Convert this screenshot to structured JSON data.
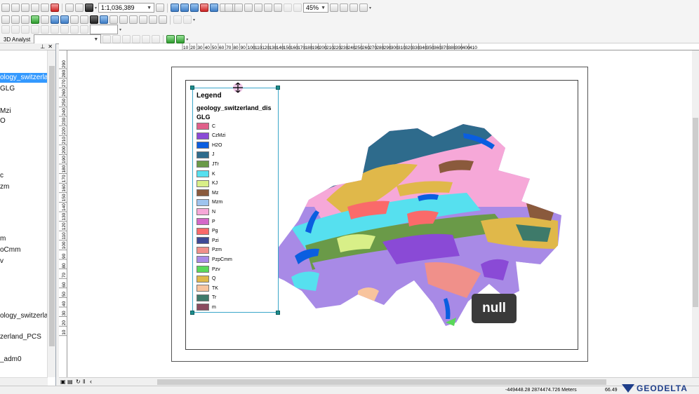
{
  "toolbar": {
    "scale_value": "1:1,036,389",
    "zoom_value": "45%",
    "analyst_label": "3D Analyst",
    "analyst_layer_value": ""
  },
  "toc": {
    "items": [
      {
        "label": "ology_switzerlan",
        "selected": true
      },
      {
        "label": "GLG"
      },
      {
        "label": "Mzi"
      },
      {
        "label": "O"
      },
      {
        "label": "c"
      },
      {
        "label": "zm"
      },
      {
        "label": "m"
      },
      {
        "label": "oCmm"
      },
      {
        "label": "v"
      },
      {
        "label": "ology_switzerland"
      },
      {
        "label": "zerland_PCS"
      },
      {
        "label": "_adm0"
      }
    ]
  },
  "ruler": {
    "h_ticks": [
      "10",
      "20",
      "30",
      "40",
      "50",
      "60",
      "70",
      "80",
      "90",
      "100",
      "110",
      "120",
      "130",
      "140",
      "150",
      "160",
      "170",
      "180",
      "190",
      "200",
      "210",
      "220",
      "230",
      "240",
      "250",
      "260",
      "270",
      "280",
      "290",
      "300",
      "310",
      "320",
      "330",
      "340",
      "350",
      "360",
      "370",
      "380",
      "390",
      "400",
      "410"
    ],
    "v_ticks": [
      "290",
      "280",
      "270",
      "260",
      "250",
      "240",
      "230",
      "220",
      "210",
      "200",
      "190",
      "180",
      "170",
      "160",
      "150",
      "140",
      "130",
      "120",
      "110",
      "100",
      "90",
      "80",
      "70",
      "60",
      "50",
      "40",
      "30",
      "20",
      "10"
    ]
  },
  "legend": {
    "title": "Legend",
    "layer": "geology_switzerland_dis",
    "field": "GLG",
    "items": [
      {
        "label": "C",
        "color": "#e0608a"
      },
      {
        "label": "CzMzi",
        "color": "#8a4ad6"
      },
      {
        "label": "H2O",
        "color": "#0a5ee0"
      },
      {
        "label": "J",
        "color": "#2e6b8c"
      },
      {
        "label": "JTr",
        "color": "#6a9a48"
      },
      {
        "label": "K",
        "color": "#56e0ef"
      },
      {
        "label": "KJ",
        "color": "#d8ef88"
      },
      {
        "label": "Mz",
        "color": "#8a5a3c"
      },
      {
        "label": "Mzm",
        "color": "#9ec4ee"
      },
      {
        "label": "N",
        "color": "#f6a8d8"
      },
      {
        "label": "P",
        "color": "#d468c8"
      },
      {
        "label": "Pg",
        "color": "#fa6a6a"
      },
      {
        "label": "Pzi",
        "color": "#3e4a96"
      },
      {
        "label": "Pzm",
        "color": "#f0908a"
      },
      {
        "label": "PzpCmm",
        "color": "#a88ae6"
      },
      {
        "label": "Pzv",
        "color": "#5ad85a"
      },
      {
        "label": "Q",
        "color": "#e0b84a"
      },
      {
        "label": "TK",
        "color": "#f8c49e"
      },
      {
        "label": "Tr",
        "color": "#3e7a6a"
      },
      {
        "label": "m",
        "color": "#8a4a5e"
      }
    ]
  },
  "tooltip": {
    "text": "null"
  },
  "status": {
    "coords": "-449448.28  2874474.726 Meters",
    "scale_readout": "66.49"
  },
  "brand": {
    "name": "GEODELTA"
  }
}
